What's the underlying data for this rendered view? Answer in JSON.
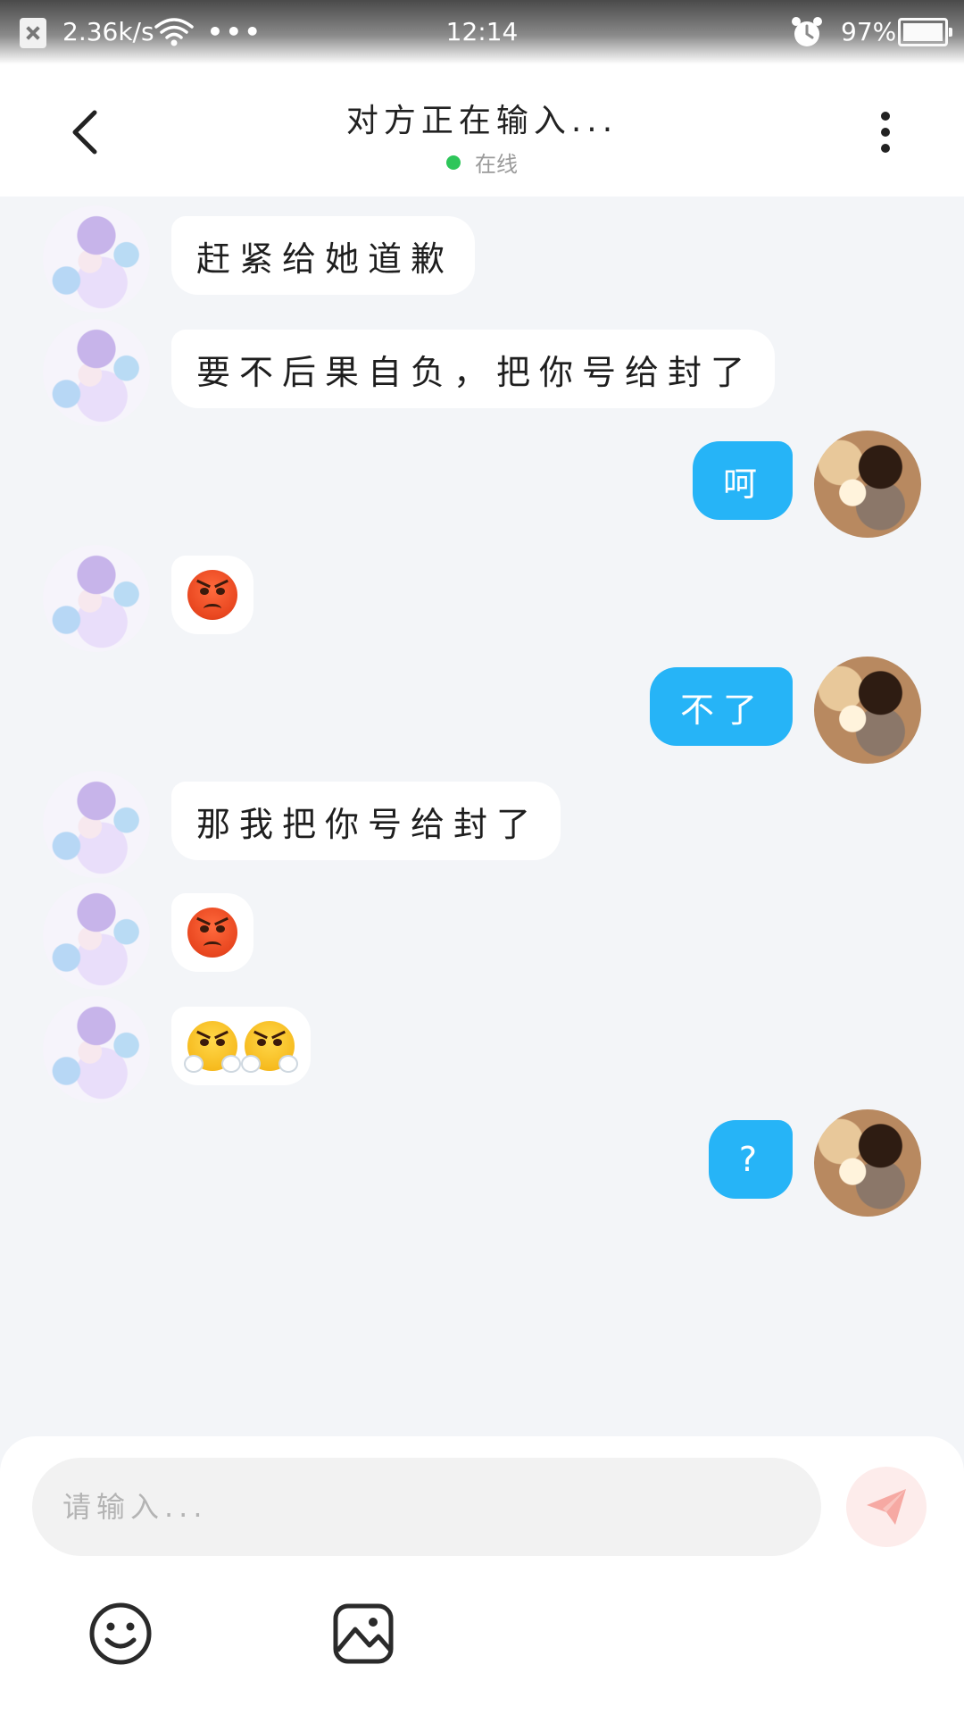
{
  "status_bar": {
    "speed": "2.36k/s",
    "dots": "•••",
    "time": "12:14",
    "battery": "97%"
  },
  "header": {
    "title": "对方正在输入...",
    "status": "在线",
    "status_color": "#2ec65a"
  },
  "messages": [
    {
      "side": "left",
      "type": "text",
      "text": "赶紧给她道歉"
    },
    {
      "side": "left",
      "type": "text",
      "text": "要不后果自负，把你号给封了"
    },
    {
      "side": "right",
      "type": "text",
      "text": "呵"
    },
    {
      "side": "left",
      "type": "emoji",
      "emoji": [
        "angry-face"
      ]
    },
    {
      "side": "right",
      "type": "text",
      "text": "不了"
    },
    {
      "side": "left",
      "type": "text",
      "text": "那我把你号给封了"
    },
    {
      "side": "left",
      "type": "emoji",
      "emoji": [
        "angry-face"
      ]
    },
    {
      "side": "left",
      "type": "emoji",
      "emoji": [
        "huffing-face",
        "huffing-face"
      ]
    },
    {
      "side": "right",
      "type": "text",
      "text": "?"
    }
  ],
  "input": {
    "placeholder": "请输入...",
    "value": ""
  },
  "icons": {
    "back": "chevron-left-icon",
    "more": "more-vertical-icon",
    "send": "paper-plane-icon",
    "emoji": "smiley-icon",
    "image": "image-icon"
  },
  "colors": {
    "accent": "#26b4f7",
    "send_button": "#fdeceb",
    "send_icon": "#f6a9a3"
  }
}
